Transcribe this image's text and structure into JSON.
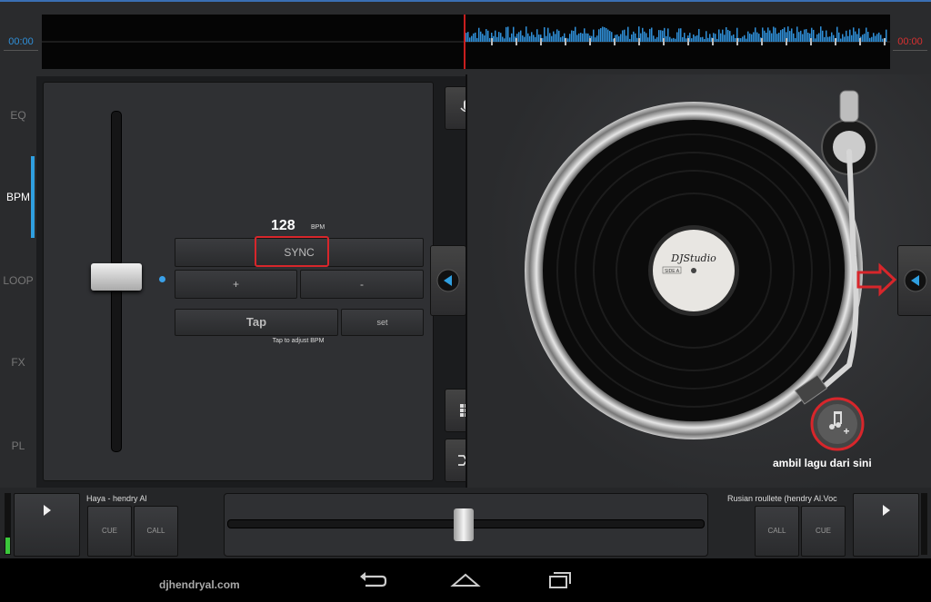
{
  "waveform": {
    "time_left": "00:00",
    "time_right": "00:00"
  },
  "sidebar": {
    "tabs": [
      {
        "label": "EQ",
        "active": false
      },
      {
        "label": "BPM",
        "active": true
      },
      {
        "label": "LOOP",
        "active": false
      },
      {
        "label": "FX",
        "active": false
      },
      {
        "label": "PL",
        "active": false
      }
    ]
  },
  "bpm_panel": {
    "bpm_value": "128",
    "bpm_unit": "BPM",
    "sync_label": "SYNC",
    "plus_label": "+",
    "minus_label": "-",
    "tap_label": "Tap",
    "set_label": "set",
    "hint": "Tap to adjust BPM"
  },
  "deck": {
    "record_label": "DJStudio",
    "side_label": "SIDE A",
    "annotation_caption": "ambil lagu dari sini"
  },
  "bottom": {
    "left_track_title": "Haya - hendry Al",
    "right_track_title": "Rusian roullete (hendry Al.Voc",
    "cue_label": "CUE",
    "call_label": "CALL",
    "crossfader_position": 0.5
  },
  "watermark": "djhendryal.com",
  "colors": {
    "accent": "#2f9fe0",
    "highlight": "#d7262b",
    "waveform": "#2f8fd8"
  }
}
